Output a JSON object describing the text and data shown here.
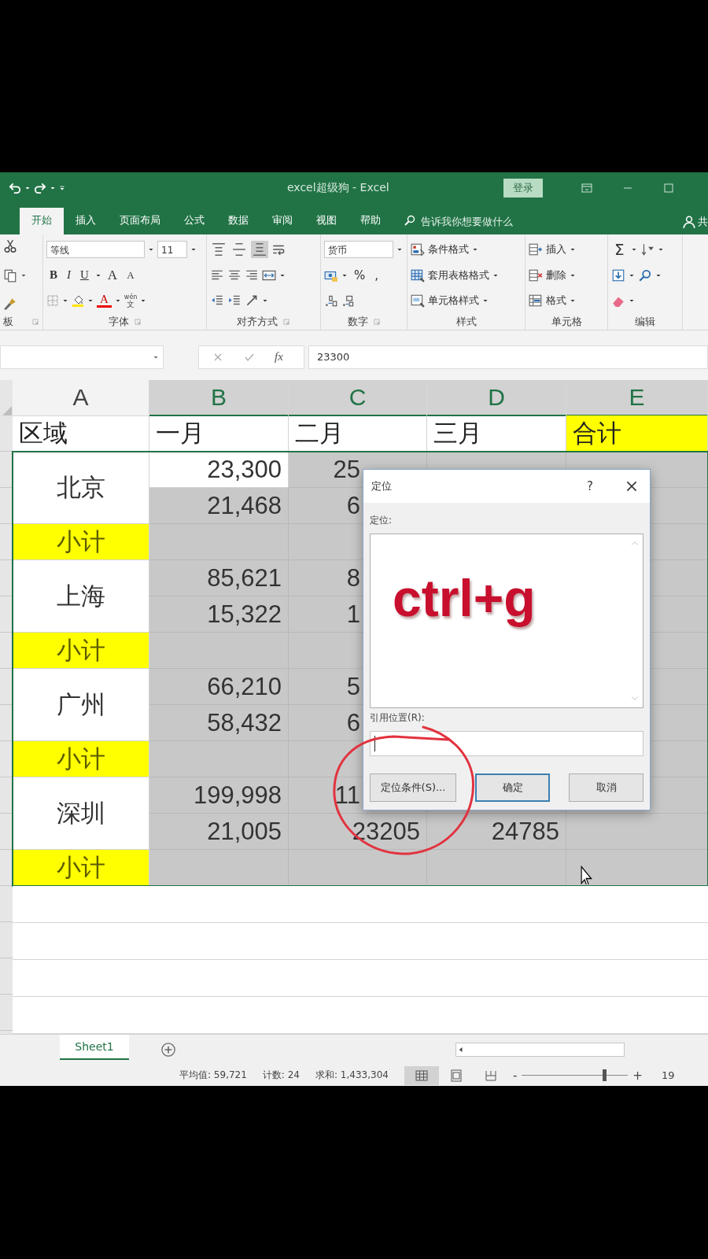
{
  "title_bar": {
    "title": "excel超级狗 - Excel",
    "login": "登录"
  },
  "tabs": [
    {
      "label": "开始",
      "selected": true
    },
    {
      "label": "插入",
      "selected": false
    },
    {
      "label": "页面布局",
      "selected": false
    },
    {
      "label": "公式",
      "selected": false
    },
    {
      "label": "数据",
      "selected": false
    },
    {
      "label": "审阅",
      "selected": false
    },
    {
      "label": "视图",
      "selected": false
    },
    {
      "label": "帮助",
      "selected": false
    }
  ],
  "tell_me": {
    "placeholder": "告诉我你想要做什么"
  },
  "share": {
    "label": "共"
  },
  "ribbon": {
    "clipboard": {
      "group_label": "板"
    },
    "font": {
      "font_name": "等线",
      "font_size": "11",
      "bold": "B",
      "italic": "I",
      "underline": "U",
      "grow": "A",
      "shrink": "A",
      "font_color": "A",
      "phonetic": "wén",
      "phonetic_base": "文",
      "group_label": "字体"
    },
    "alignment": {
      "vertical": [
        {
          "kind": "top",
          "selected": false
        },
        {
          "kind": "middle",
          "selected": false
        },
        {
          "kind": "bottom",
          "selected": true
        }
      ],
      "group_label": "对齐方式"
    },
    "number": {
      "format": "货币",
      "percent": "%",
      "comma": ",",
      "group_label": "数字"
    },
    "styles": {
      "commands": [
        "条件格式",
        "套用表格格式",
        "单元格样式"
      ],
      "group_label": "样式"
    },
    "cells": {
      "commands": [
        "插入",
        "删除",
        "格式"
      ],
      "group_label": "单元格"
    },
    "editing": {
      "sum": "Σ",
      "group_label": "编辑"
    }
  },
  "formula_bar": {
    "insert_function": "fx",
    "value": "23300"
  },
  "sheet": {
    "columns": [
      {
        "label": "A",
        "selected": false
      },
      {
        "label": "B",
        "selected": true
      },
      {
        "label": "C",
        "selected": true
      },
      {
        "label": "D",
        "selected": true
      },
      {
        "label": "E",
        "selected": true
      }
    ],
    "header_row": [
      {
        "text": "区域",
        "highlight": false
      },
      {
        "text": "一月",
        "highlight": false
      },
      {
        "text": "二月",
        "highlight": false
      },
      {
        "text": "三月",
        "highlight": false
      },
      {
        "text": "合计",
        "highlight": true
      }
    ],
    "blocks": [
      {
        "region": "北京",
        "subtotal": "小计",
        "rows": [
          [
            {
              "text": "23,300",
              "selected": false
            },
            {
              "text": "25",
              "cut": true,
              "selected": true
            },
            {
              "selected": true
            },
            {
              "selected": true
            }
          ],
          [
            {
              "text": "21,468",
              "selected": true
            },
            {
              "text": "6",
              "cut": true,
              "selected": true
            },
            null,
            {
              "selected": true
            }
          ]
        ],
        "subtotal_cells": [
          {
            "selected": true
          },
          {
            "selected": true
          },
          null,
          {
            "selected": true
          }
        ]
      },
      {
        "region": "上海",
        "subtotal": "小计",
        "rows": [
          [
            {
              "text": "85,621",
              "selected": true
            },
            {
              "text": "8",
              "cut": true,
              "selected": true
            },
            null,
            {
              "selected": true
            }
          ],
          [
            {
              "text": "15,322",
              "selected": true
            },
            {
              "text": "1",
              "cut": true,
              "selected": true
            },
            null,
            {
              "selected": true
            }
          ]
        ],
        "subtotal_cells": [
          {
            "selected": true
          },
          {
            "selected": true
          },
          null,
          {
            "selected": true
          }
        ]
      },
      {
        "region": "广州",
        "subtotal": "小计",
        "rows": [
          [
            {
              "text": "66,210",
              "selected": true
            },
            {
              "text": "5",
              "cut": true,
              "selected": true
            },
            null,
            {
              "selected": true
            }
          ],
          [
            {
              "text": "58,432",
              "selected": true
            },
            {
              "text": "6",
              "cut": true,
              "selected": true
            },
            null,
            {
              "selected": true
            }
          ]
        ],
        "subtotal_cells": [
          {
            "selected": true
          },
          {
            "selected": true
          },
          null,
          {
            "selected": true
          }
        ]
      },
      {
        "region": "深圳",
        "subtotal": "小计",
        "rows": [
          [
            {
              "text": "199,998",
              "selected": true
            },
            {
              "text": "11",
              "cut": true,
              "selected": true
            },
            null,
            {
              "selected": true
            }
          ],
          [
            {
              "text": "21,005",
              "selected": true
            },
            {
              "text": "23205",
              "selected": true
            },
            {
              "text": "24785",
              "selected": true
            },
            {
              "selected": true
            }
          ]
        ],
        "subtotal_cells": [
          {
            "selected": true
          },
          {
            "selected": true
          },
          {
            "selected": true
          },
          {
            "selected": true
          }
        ]
      }
    ]
  },
  "dialog": {
    "title": "定位",
    "help": "?",
    "list_label": "定位:",
    "overlay_text": "ctrl+g",
    "reference_label": "引用位置(R):",
    "buttons": [
      {
        "label": "定位条件(S)...",
        "default": false
      },
      {
        "label": "确定",
        "default": true
      },
      {
        "label": "取消",
        "default": false
      }
    ]
  },
  "sheet_tabs": [
    {
      "label": "Sheet1",
      "selected": true
    }
  ],
  "status_bar": {
    "stats": [
      "平均值: 59,721",
      "计数: 24",
      "求和: 1,433,304"
    ],
    "views": [
      {
        "kind": "normal",
        "selected": true
      },
      {
        "kind": "page_layout",
        "selected": false
      },
      {
        "kind": "page_break",
        "selected": false
      }
    ],
    "zoom": {
      "minus": "-",
      "plus": "+",
      "level": 0.78,
      "label": "19"
    }
  }
}
